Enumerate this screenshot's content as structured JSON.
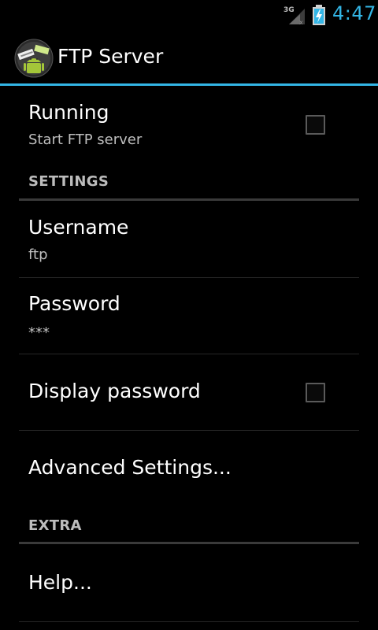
{
  "status_bar": {
    "network_type": "3G",
    "time": "4:47",
    "signal_icon": "signal-icon",
    "battery_icon": "battery-charging-icon",
    "accent_color": "#33b5e5"
  },
  "action_bar": {
    "title": "FTP Server",
    "app_icon": "ftp-server-app-icon"
  },
  "preferences": {
    "running": {
      "title": "Running",
      "summary": "Start FTP server",
      "checked": false
    },
    "settings_header": "SETTINGS",
    "username": {
      "title": "Username",
      "summary": "ftp"
    },
    "password": {
      "title": "Password",
      "summary": "***"
    },
    "display_password": {
      "title": "Display password",
      "checked": false
    },
    "advanced": {
      "title": "Advanced Settings..."
    },
    "extra_header": "EXTRA",
    "help": {
      "title": "Help..."
    }
  }
}
